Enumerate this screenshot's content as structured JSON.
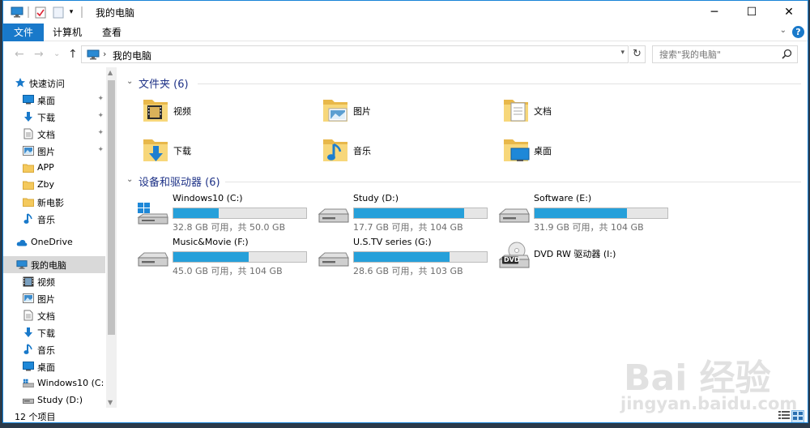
{
  "window": {
    "title": "我的电脑",
    "controls": {
      "minimize": "─",
      "maximize": "☐",
      "close": "✕"
    }
  },
  "ribbon": {
    "tabs": [
      {
        "label": "文件"
      },
      {
        "label": "计算机"
      },
      {
        "label": "查看"
      }
    ],
    "expand_glyph": "⌄",
    "help_glyph": "?"
  },
  "address": {
    "back": "←",
    "forward": "→",
    "recent": "⌄",
    "up": "↑",
    "separator": "›",
    "path": "我的电脑",
    "dropdown": "▾",
    "refresh": "↻"
  },
  "search": {
    "placeholder": "搜索\"我的电脑\""
  },
  "nav": {
    "items": [
      {
        "label": "快速访问",
        "icon": "star-icon"
      },
      {
        "label": "桌面",
        "icon": "desktop-icon",
        "pinned": true
      },
      {
        "label": "下载",
        "icon": "download-icon",
        "pinned": true
      },
      {
        "label": "文档",
        "icon": "document-icon",
        "pinned": true
      },
      {
        "label": "图片",
        "icon": "pictures-icon",
        "pinned": true
      },
      {
        "label": "APP",
        "icon": "folder-icon"
      },
      {
        "label": "Zby",
        "icon": "folder-icon"
      },
      {
        "label": "新电影",
        "icon": "folder-icon"
      },
      {
        "label": "音乐",
        "icon": "music-icon"
      },
      {
        "label": "OneDrive",
        "icon": "cloud-icon"
      },
      {
        "label": "我的电脑",
        "icon": "computer-icon",
        "selected": true
      },
      {
        "label": "视频",
        "icon": "video-icon"
      },
      {
        "label": "图片",
        "icon": "pictures-icon"
      },
      {
        "label": "文档",
        "icon": "document-icon"
      },
      {
        "label": "下载",
        "icon": "download-icon"
      },
      {
        "label": "音乐",
        "icon": "music-icon"
      },
      {
        "label": "桌面",
        "icon": "desktop-icon"
      },
      {
        "label": "Windows10 (C:",
        "icon": "windows-drive-icon"
      },
      {
        "label": "Study (D:)",
        "icon": "drive-icon"
      }
    ],
    "pin_glyph": "✦"
  },
  "content": {
    "folders_group": {
      "title": "文件夹 (6)",
      "chevron": "⌄"
    },
    "folders": [
      {
        "label": "视频",
        "icon": "video-folder-icon"
      },
      {
        "label": "图片",
        "icon": "pictures-folder-icon"
      },
      {
        "label": "文档",
        "icon": "documents-folder-icon"
      },
      {
        "label": "下载",
        "icon": "downloads-folder-icon"
      },
      {
        "label": "音乐",
        "icon": "music-folder-icon"
      },
      {
        "label": "桌面",
        "icon": "desktop-folder-icon"
      }
    ],
    "drives_group": {
      "title": "设备和驱动器 (6)",
      "chevron": "⌄"
    },
    "drives": [
      {
        "name": "Windows10 (C:)",
        "free": "32.8 GB 可用，共 50.0 GB",
        "used_fraction": 0.344,
        "icon": "windows-drive-icon"
      },
      {
        "name": "Study (D:)",
        "free": "17.7 GB 可用，共 104 GB",
        "used_fraction": 0.83,
        "icon": "hard-drive-icon"
      },
      {
        "name": "Software (E:)",
        "free": "31.9 GB 可用，共 104 GB",
        "used_fraction": 0.693,
        "icon": "hard-drive-icon"
      },
      {
        "name": "Music&Movie (F:)",
        "free": "45.0 GB 可用，共 104 GB",
        "used_fraction": 0.567,
        "icon": "hard-drive-icon"
      },
      {
        "name": "U.S.TV series  (G:)",
        "free": "28.6 GB 可用，共 103 GB",
        "used_fraction": 0.722,
        "icon": "hard-drive-icon"
      },
      {
        "name": "DVD RW 驱动器 (I:)",
        "icon": "dvd-drive-icon",
        "dvd_text": "DVD"
      }
    ]
  },
  "status": {
    "text": "12 个项目"
  },
  "watermark": {
    "brand": "Bai 经验",
    "url": "jingyan.baidu.com"
  },
  "colors": {
    "accent": "#1979ca",
    "bar_fill": "#26a0da",
    "group_title": "#1e3287",
    "selected": "#d9d9d9"
  }
}
